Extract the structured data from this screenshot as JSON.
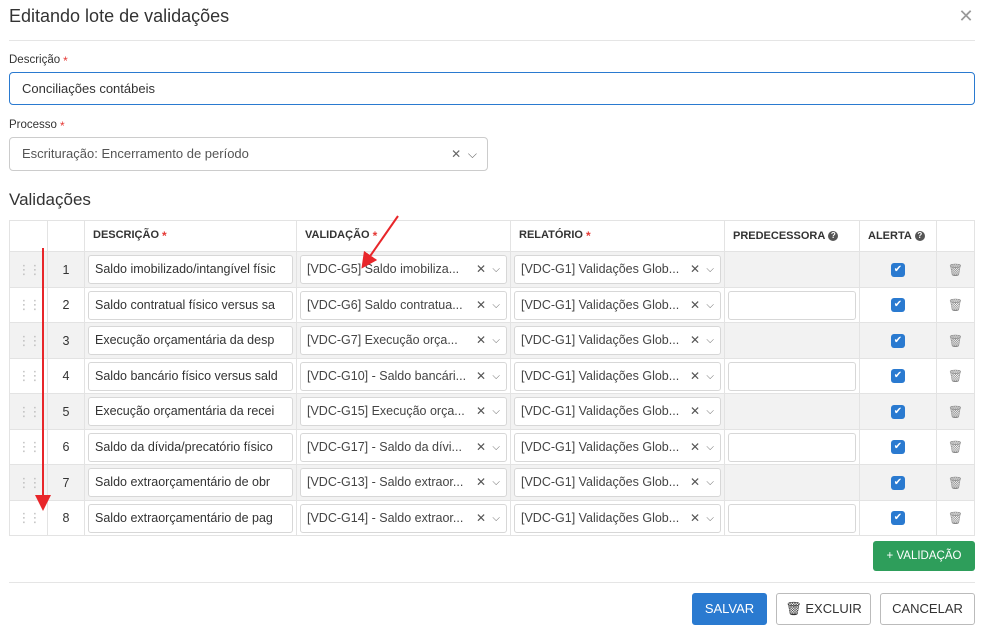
{
  "modal": {
    "title": "Editando lote de validações",
    "close_icon": "close-icon"
  },
  "form": {
    "descricao_label": "Descrição",
    "descricao_value": "Conciliações contábeis",
    "processo_label": "Processo",
    "processo_value": "Escrituração: Encerramento de período",
    "required_mark": "*"
  },
  "section": {
    "title": "Validações"
  },
  "table": {
    "headers": {
      "descricao": "DESCRIÇÃO",
      "validacao": "VALIDAÇÃO",
      "relatorio": "RELATÓRIO",
      "predecessora": "PREDECESSORA",
      "alerta": "ALERTA"
    },
    "rows": [
      {
        "num": "1",
        "descricao": "Saldo imobilizado/intangível físic",
        "validacao": "[VDC-G5] Saldo imobiliza...",
        "relatorio": "[VDC-G1] Validações Glob...",
        "predecessora_editable": false,
        "alerta": true
      },
      {
        "num": "2",
        "descricao": "Saldo contratual físico versus sa",
        "validacao": "[VDC-G6] Saldo contratua...",
        "relatorio": "[VDC-G1] Validações Glob...",
        "predecessora_editable": true,
        "alerta": true
      },
      {
        "num": "3",
        "descricao": "Execução orçamentária da desp",
        "validacao": "[VDC-G7] Execução orça...",
        "relatorio": "[VDC-G1] Validações Glob...",
        "predecessora_editable": false,
        "alerta": true
      },
      {
        "num": "4",
        "descricao": "Saldo bancário físico versus sald",
        "validacao": "[VDC-G10] - Saldo bancári...",
        "relatorio": "[VDC-G1] Validações Glob...",
        "predecessora_editable": true,
        "alerta": true
      },
      {
        "num": "5",
        "descricao": "Execução orçamentária da recei",
        "validacao": "[VDC-G15] Execução orça...",
        "relatorio": "[VDC-G1] Validações Glob...",
        "predecessora_editable": false,
        "alerta": true
      },
      {
        "num": "6",
        "descricao": "Saldo da dívida/precatório físico",
        "validacao": "[VDC-G17] - Saldo da dívi...",
        "relatorio": "[VDC-G1] Validações Glob...",
        "predecessora_editable": true,
        "alerta": true
      },
      {
        "num": "7",
        "descricao": "Saldo extraorçamentário de obr",
        "validacao": "[VDC-G13] - Saldo extraor...",
        "relatorio": "[VDC-G1] Validações Glob...",
        "predecessora_editable": false,
        "alerta": true
      },
      {
        "num": "8",
        "descricao": "Saldo extraorçamentário de pag",
        "validacao": "[VDC-G14] - Saldo extraor...",
        "relatorio": "[VDC-G1] Validações Glob...",
        "predecessora_editable": true,
        "alerta": true
      }
    ]
  },
  "buttons": {
    "add_validacao": "+ VALIDAÇÃO",
    "salvar": "SALVAR",
    "excluir": "EXCLUIR",
    "cancelar": "CANCELAR"
  },
  "colors": {
    "primary": "#2a7ad0",
    "success": "#2e9e5b",
    "required": "#e53935",
    "annotation_arrow": "#e8262a"
  }
}
